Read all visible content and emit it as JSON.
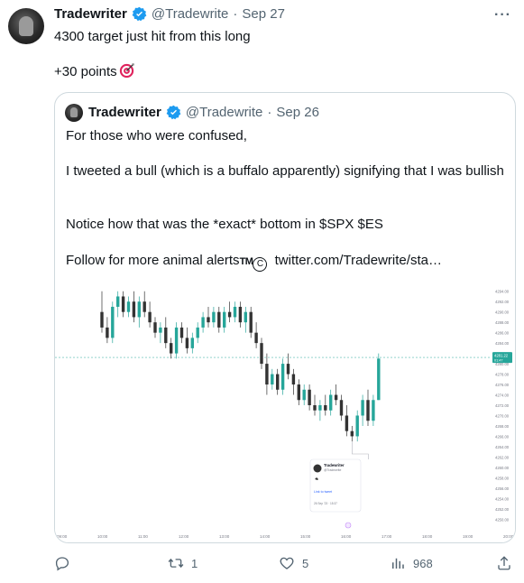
{
  "tweet": {
    "author_name": "Tradewriter",
    "handle": "@Tradewrite",
    "separator": "·",
    "date": "Sep 27",
    "line1": "4300 target just hit from this long",
    "line2": "+30 points",
    "more": "···"
  },
  "quote": {
    "author_name": "Tradewriter",
    "handle": "@Tradewrite",
    "separator": "·",
    "date": "Sep 26",
    "p1": "For those who were confused,",
    "p2": "I tweeted a bull (which is a buffalo apparently) signifying that I was bullish",
    "p3": "Notice how that was the *exact* bottom in $SPX $ES",
    "p4_prefix": "Follow for more animal alerts",
    "p4_tm": "TM",
    "p4_c": "C",
    "p4_link": "twitter.com/Tradewrite/sta…"
  },
  "chart_data": {
    "type": "candlestick",
    "x_ticks": [
      "09:00",
      "10:00",
      "11:00",
      "12:00",
      "13:00",
      "14:00",
      "15:00",
      "16:00",
      "17:00",
      "18:00",
      "19:00",
      "20:00"
    ],
    "y_ticks": [
      "4294.00",
      "4292.00",
      "4290.00",
      "4288.00",
      "4286.00",
      "4284.00",
      "4282.00",
      "4280.00",
      "4278.00",
      "4276.00",
      "4274.00",
      "4272.00",
      "4270.00",
      "4268.00",
      "4266.00",
      "4264.00",
      "4262.00",
      "4260.00",
      "4258.00",
      "4256.00",
      "4254.00",
      "4252.00",
      "4250.00"
    ],
    "ylim": [
      4249,
      4295
    ],
    "last_price": "4281.22",
    "last_price_sub": "01:47",
    "up_color": "#26a69a",
    "down_color": "#333333",
    "candles": [
      {
        "o": 4290,
        "h": 4294,
        "l": 4286,
        "c": 4287
      },
      {
        "o": 4287,
        "h": 4289,
        "l": 4284,
        "c": 4285
      },
      {
        "o": 4285,
        "h": 4292,
        "l": 4284,
        "c": 4291
      },
      {
        "o": 4291,
        "h": 4294,
        "l": 4289,
        "c": 4293
      },
      {
        "o": 4293,
        "h": 4294,
        "l": 4289,
        "c": 4290
      },
      {
        "o": 4290,
        "h": 4293,
        "l": 4289,
        "c": 4292
      },
      {
        "o": 4292,
        "h": 4294,
        "l": 4288,
        "c": 4289
      },
      {
        "o": 4289,
        "h": 4293,
        "l": 4287,
        "c": 4292
      },
      {
        "o": 4292,
        "h": 4294,
        "l": 4289,
        "c": 4290
      },
      {
        "o": 4290,
        "h": 4292,
        "l": 4287,
        "c": 4288
      },
      {
        "o": 4288,
        "h": 4289,
        "l": 4285,
        "c": 4286
      },
      {
        "o": 4286,
        "h": 4288,
        "l": 4284,
        "c": 4287
      },
      {
        "o": 4287,
        "h": 4289,
        "l": 4283,
        "c": 4284
      },
      {
        "o": 4284,
        "h": 4285,
        "l": 4281,
        "c": 4282
      },
      {
        "o": 4282,
        "h": 4288,
        "l": 4281,
        "c": 4287
      },
      {
        "o": 4287,
        "h": 4288,
        "l": 4284,
        "c": 4285
      },
      {
        "o": 4285,
        "h": 4287,
        "l": 4282,
        "c": 4283
      },
      {
        "o": 4283,
        "h": 4286,
        "l": 4282,
        "c": 4285
      },
      {
        "o": 4285,
        "h": 4288,
        "l": 4284,
        "c": 4287
      },
      {
        "o": 4287,
        "h": 4290,
        "l": 4286,
        "c": 4289
      },
      {
        "o": 4289,
        "h": 4291,
        "l": 4287,
        "c": 4288
      },
      {
        "o": 4288,
        "h": 4291,
        "l": 4287,
        "c": 4290
      },
      {
        "o": 4290,
        "h": 4291,
        "l": 4286,
        "c": 4287
      },
      {
        "o": 4287,
        "h": 4291,
        "l": 4286,
        "c": 4290
      },
      {
        "o": 4290,
        "h": 4292,
        "l": 4288,
        "c": 4289
      },
      {
        "o": 4289,
        "h": 4292,
        "l": 4288,
        "c": 4291
      },
      {
        "o": 4291,
        "h": 4292,
        "l": 4287,
        "c": 4288
      },
      {
        "o": 4288,
        "h": 4291,
        "l": 4286,
        "c": 4290
      },
      {
        "o": 4290,
        "h": 4291,
        "l": 4285,
        "c": 4286
      },
      {
        "o": 4286,
        "h": 4288,
        "l": 4283,
        "c": 4284
      },
      {
        "o": 4284,
        "h": 4285,
        "l": 4279,
        "c": 4280
      },
      {
        "o": 4280,
        "h": 4282,
        "l": 4274,
        "c": 4276
      },
      {
        "o": 4276,
        "h": 4279,
        "l": 4275,
        "c": 4278
      },
      {
        "o": 4278,
        "h": 4279,
        "l": 4274,
        "c": 4275
      },
      {
        "o": 4275,
        "h": 4281,
        "l": 4274,
        "c": 4280
      },
      {
        "o": 4280,
        "h": 4282,
        "l": 4277,
        "c": 4278
      },
      {
        "o": 4278,
        "h": 4279,
        "l": 4274,
        "c": 4276
      },
      {
        "o": 4276,
        "h": 4277,
        "l": 4272,
        "c": 4273
      },
      {
        "o": 4273,
        "h": 4276,
        "l": 4272,
        "c": 4275
      },
      {
        "o": 4275,
        "h": 4276,
        "l": 4271,
        "c": 4272
      },
      {
        "o": 4272,
        "h": 4274,
        "l": 4270,
        "c": 4271
      },
      {
        "o": 4271,
        "h": 4273,
        "l": 4269,
        "c": 4272
      },
      {
        "o": 4272,
        "h": 4274,
        "l": 4270,
        "c": 4271
      },
      {
        "o": 4271,
        "h": 4275,
        "l": 4270,
        "c": 4274
      },
      {
        "o": 4274,
        "h": 4276,
        "l": 4272,
        "c": 4273
      },
      {
        "o": 4273,
        "h": 4274,
        "l": 4269,
        "c": 4270
      },
      {
        "o": 4270,
        "h": 4272,
        "l": 4266,
        "c": 4267
      },
      {
        "o": 4267,
        "h": 4268,
        "l": 4265,
        "c": 4266
      },
      {
        "o": 4266,
        "h": 4271,
        "l": 4265,
        "c": 4270
      },
      {
        "o": 4270,
        "h": 4274,
        "l": 4268,
        "c": 4273
      },
      {
        "o": 4273,
        "h": 4275,
        "l": 4268,
        "c": 4269
      },
      {
        "o": 4269,
        "h": 4274,
        "l": 4268,
        "c": 4273
      },
      {
        "o": 4273,
        "h": 4282,
        "l": 4273,
        "c": 4281
      }
    ],
    "popup": {
      "name": "Tradewriter",
      "handle": "@Tradewrite",
      "link": "Link to tweet",
      "stamp": "26 Sep '23 · 15:37"
    }
  },
  "actions": {
    "reply_count": "",
    "retweet_count": "1",
    "like_count": "5",
    "views_count": "968"
  }
}
